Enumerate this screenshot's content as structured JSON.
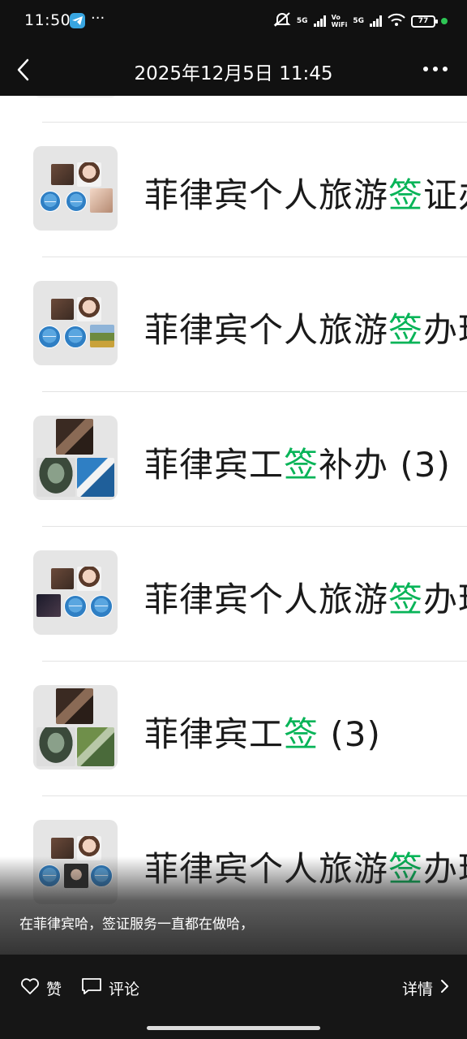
{
  "status_bar": {
    "time": "11:50",
    "more": "···",
    "net1": "5G",
    "volte_top": "Vo",
    "volte_bottom": "WiFi",
    "net2": "5G",
    "battery": "77",
    "icons": [
      "telegram-icon",
      "mute-icon",
      "signal-icon",
      "wifi-icon",
      "battery-icon"
    ]
  },
  "nav": {
    "title": "2025年12月5日 11:45",
    "back_icon": "back-arrow-icon",
    "more_icon": "more-dots-icon"
  },
  "chats": [
    {
      "pre": "菲律宾个人旅游",
      "hl": "签",
      "post": "证办"
    },
    {
      "pre": "菲律宾个人旅游",
      "hl": "签",
      "post": "办理"
    },
    {
      "pre": "菲律宾工",
      "hl": "签",
      "post": "补办 (3)"
    },
    {
      "pre": "菲律宾个人旅游",
      "hl": "签",
      "post": "办理"
    },
    {
      "pre": "菲律宾工",
      "hl": "签",
      "post": " (3)"
    },
    {
      "pre": "菲律宾个人旅游",
      "hl": "签",
      "post": "办理"
    }
  ],
  "caption": "在菲律宾哈，签证服务一直都在做哈，",
  "bottom": {
    "like_label": "赞",
    "comment_label": "评论",
    "detail_label": "详情"
  },
  "colors": {
    "highlight": "#07b458",
    "bar_bg": "#111111",
    "content_bg": "#ffffff"
  }
}
